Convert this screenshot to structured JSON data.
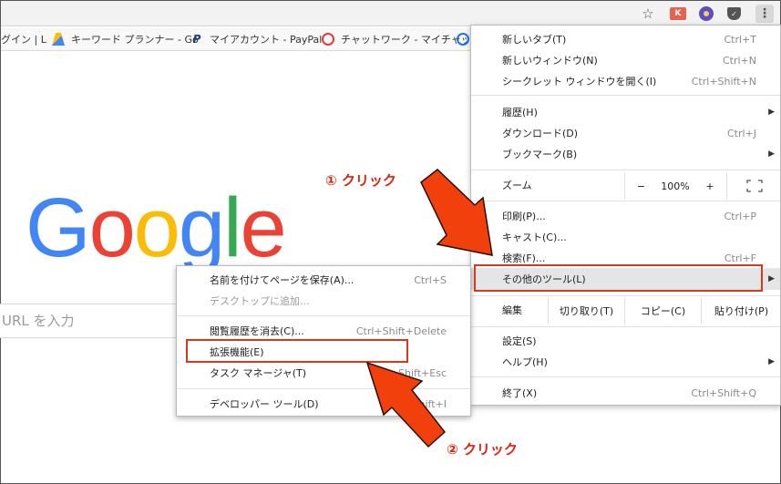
{
  "toolbar": {
    "bookmark_star": "☆",
    "ext_label": "K",
    "menu_glyph": "⋮"
  },
  "bookmarks": [
    {
      "label": "グイン | L",
      "icon": "none"
    },
    {
      "label": "キーワード プランナー - Go",
      "icon": "google-ads-icon"
    },
    {
      "label": "マイアカウント - PayPal",
      "icon": "paypal-icon"
    },
    {
      "label": "チャットワーク - マイチャッ",
      "icon": "chatwork-icon"
    }
  ],
  "paypal_glyph": "P",
  "google_logo": [
    "G",
    "o",
    "o",
    "g",
    "l",
    "e"
  ],
  "search": {
    "placeholder": "URL を入力"
  },
  "menu": {
    "new_tab": {
      "label": "新しいタブ(T)",
      "shortcut": "Ctrl+T"
    },
    "new_window": {
      "label": "新しいウィンドウ(N)",
      "shortcut": "Ctrl+N"
    },
    "incognito": {
      "label": "シークレット ウィンドウを開く(I)",
      "shortcut": "Ctrl+Shift+N"
    },
    "history": {
      "label": "履歴(H)",
      "arrow": "▶"
    },
    "downloads": {
      "label": "ダウンロード(D)",
      "shortcut": "Ctrl+J"
    },
    "bookmarks": {
      "label": "ブックマーク(B)",
      "arrow": "▶"
    },
    "zoom": {
      "label": "ズーム",
      "minus": "−",
      "value": "100%",
      "plus": "+"
    },
    "print": {
      "label": "印刷(P)...",
      "shortcut": "Ctrl+P"
    },
    "cast": {
      "label": "キャスト(C)..."
    },
    "find": {
      "label": "検索(F)...",
      "shortcut": "Ctrl+F"
    },
    "more_tools": {
      "label": "その他のツール(L)",
      "arrow": "▶"
    },
    "edit": {
      "label": "編集",
      "cut": "切り取り(T)",
      "copy": "コピー(C)",
      "paste": "貼り付け(P)"
    },
    "settings": {
      "label": "設定(S)"
    },
    "help": {
      "label": "ヘルプ(H)",
      "arrow": "▶"
    },
    "exit": {
      "label": "終了(X)",
      "shortcut": "Ctrl+Shift+Q"
    }
  },
  "submenu": {
    "save_page": {
      "label": "名前を付けてページを保存(A)...",
      "shortcut": "Ctrl+S"
    },
    "add_desktop": {
      "label": "デスクトップに追加..."
    },
    "clear_data": {
      "label": "閲覧履歴を消去(C)...",
      "shortcut": "Ctrl+Shift+Delete"
    },
    "extensions": {
      "label": "拡張機能(E)"
    },
    "task_manager": {
      "label": "タスク マネージャ(T)",
      "shortcut": "Shift+Esc"
    },
    "dev_tools": {
      "label": "デベロッパー ツール(D)",
      "shortcut": "Shift+I"
    }
  },
  "annotations": {
    "step1": "① クリック",
    "step2": "② クリック"
  },
  "colors": {
    "annotation_red": "#e0200c",
    "box_red": "#d63a1a",
    "arrow_fill": "#f2400c"
  }
}
